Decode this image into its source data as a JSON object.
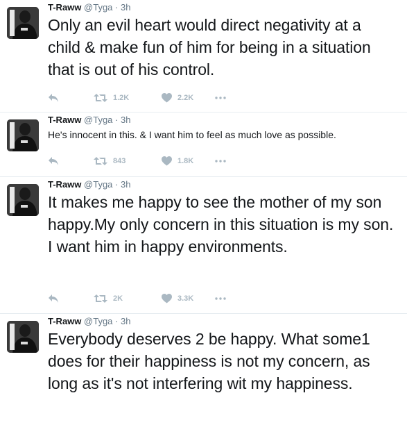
{
  "tweets": [
    {
      "name": "T-Raww",
      "handle": "@Tyga",
      "sep": "·",
      "time": "3h",
      "text": "Only an evil heart would direct negativity at a child & make fun of him for being in a situation that is out of his control.",
      "retweets": "1.2K",
      "likes": "2.2K"
    },
    {
      "name": "T-Raww",
      "handle": "@Tyga",
      "sep": "·",
      "time": "3h",
      "text": "He's innocent in this. & I want him to feel as much love as possible.",
      "retweets": "843",
      "likes": "1.8K"
    },
    {
      "name": "T-Raww",
      "handle": "@Tyga",
      "sep": "·",
      "time": "3h",
      "text": "It makes me happy to see the mother of my son happy.My only concern in this situation is my son. I want him in happy environments.",
      "retweets": "2K",
      "likes": "3.3K"
    },
    {
      "name": "T-Raww",
      "handle": "@Tyga",
      "sep": "·",
      "time": "3h",
      "text": "Everybody deserves 2 be happy. What some1 does for their happiness is not my concern, as long as it's not interfering wit my happiness."
    }
  ],
  "icons": {
    "reply": "reply-icon",
    "retweet": "retweet-icon",
    "like": "heart-icon",
    "more": "more-icon"
  },
  "colors": {
    "text": "#14171a",
    "meta": "#657786",
    "action": "#aab8c2",
    "divider": "#e6ecf0"
  }
}
